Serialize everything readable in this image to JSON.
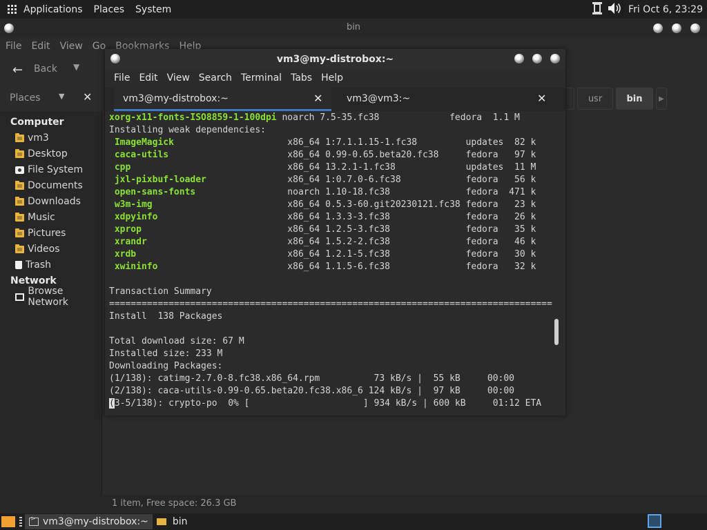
{
  "top_panel": {
    "menus": [
      "Applications",
      "Places",
      "System"
    ],
    "clock": "Fri Oct  6, 23:29"
  },
  "file_manager": {
    "title": "bin",
    "menu": [
      "File",
      "Edit",
      "View",
      "Go",
      "Bookmarks",
      "Help"
    ],
    "back_label": "Back",
    "places_label": "Places",
    "path_crumbs": [
      "usr",
      "bin"
    ],
    "sidebar": {
      "computer_heading": "Computer",
      "computer_items": [
        {
          "label": "vm3",
          "icon": "home-folder-icon"
        },
        {
          "label": "Desktop",
          "icon": "folder-icon"
        },
        {
          "label": "File System",
          "icon": "drive-icon"
        },
        {
          "label": "Documents",
          "icon": "folder-icon"
        },
        {
          "label": "Downloads",
          "icon": "folder-icon"
        },
        {
          "label": "Music",
          "icon": "folder-icon"
        },
        {
          "label": "Pictures",
          "icon": "folder-icon"
        },
        {
          "label": "Videos",
          "icon": "folder-icon"
        },
        {
          "label": "Trash",
          "icon": "trash-icon"
        }
      ],
      "network_heading": "Network",
      "network_items": [
        {
          "label": "Browse Network",
          "icon": "network-icon"
        }
      ]
    },
    "status": "1 item, Free space: 26.3 GB"
  },
  "terminal": {
    "title": "vm3@my-distrobox:~",
    "menu": [
      "File",
      "Edit",
      "View",
      "Search",
      "Terminal",
      "Tabs",
      "Help"
    ],
    "tabs": [
      {
        "label": "vm3@my-distrobox:~",
        "active": true
      },
      {
        "label": "vm3@vm3:~",
        "active": false
      }
    ],
    "lines": [
      {
        "pkg": "xorg-x11-fonts-ISO8859-1-100dpi",
        "text": " noarch 7.5-35.fc38             fedora  1.1 M"
      },
      {
        "pkg": "",
        "text": "Installing weak dependencies:"
      },
      {
        "pkg": " ImageMagick",
        "text": "                     x86_64 1:7.1.1.15-1.fc38         updates  82 k"
      },
      {
        "pkg": " caca-utils",
        "text": "                      x86_64 0.99-0.65.beta20.fc38     fedora   97 k"
      },
      {
        "pkg": " cpp",
        "text": "                             x86_64 13.2.1-1.fc38             updates  11 M"
      },
      {
        "pkg": " jxl-pixbuf-loader",
        "text": "               x86_64 1:0.7.0-6.fc38            fedora   56 k"
      },
      {
        "pkg": " open-sans-fonts",
        "text": "                 noarch 1.10-18.fc38              fedora  471 k"
      },
      {
        "pkg": " w3m-img",
        "text": "                         x86_64 0.5.3-60.git20230121.fc38 fedora   23 k"
      },
      {
        "pkg": " xdpyinfo",
        "text": "                        x86_64 1.3.3-3.fc38              fedora   26 k"
      },
      {
        "pkg": " xprop",
        "text": "                           x86_64 1.2.5-3.fc38              fedora   35 k"
      },
      {
        "pkg": " xrandr",
        "text": "                          x86_64 1.5.2-2.fc38              fedora   46 k"
      },
      {
        "pkg": " xrdb",
        "text": "                            x86_64 1.2.1-5.fc38              fedora   30 k"
      },
      {
        "pkg": " xwininfo",
        "text": "                        x86_64 1.1.5-6.fc38              fedora   32 k"
      },
      {
        "pkg": "",
        "text": ""
      },
      {
        "pkg": "",
        "text": "Transaction Summary"
      },
      {
        "pkg": "",
        "text": "=================================================================================="
      },
      {
        "pkg": "",
        "text": "Install  138 Packages"
      },
      {
        "pkg": "",
        "text": ""
      },
      {
        "pkg": "",
        "text": "Total download size: 67 M"
      },
      {
        "pkg": "",
        "text": "Installed size: 233 M"
      },
      {
        "pkg": "",
        "text": "Downloading Packages:"
      },
      {
        "pkg": "",
        "text": "(1/138): catimg-2.7.0-8.fc38.x86_64.rpm          73 kB/s |  55 kB     00:00"
      },
      {
        "pkg": "",
        "text": "(2/138): caca-utils-0.99-0.65.beta20.fc38.x86_6 124 kB/s |  97 kB     00:00"
      }
    ],
    "cursor_char": "(",
    "last_line": "3-5/138): crypto-po  0% [                     ] 934 kB/s | 600 kB     01:12 ETA"
  },
  "taskbar": {
    "items": [
      "vm3@my-distrobox:~",
      "bin"
    ]
  }
}
